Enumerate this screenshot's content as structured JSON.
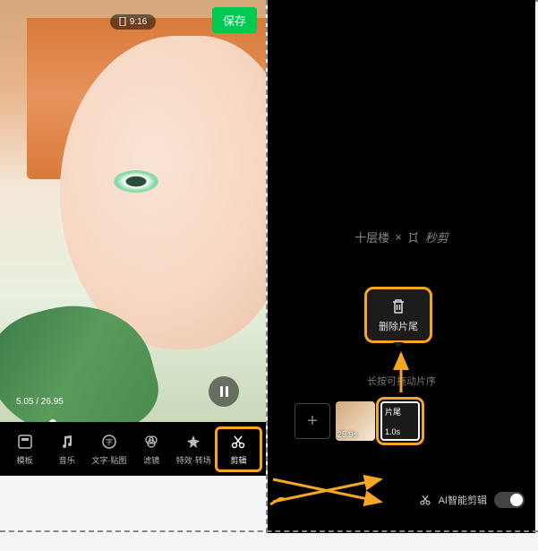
{
  "left": {
    "status_time": "9:16",
    "save_label": "保存",
    "time_display": "5.05 / 26.95",
    "toolbar": [
      {
        "icon": "template",
        "label": "模板"
      },
      {
        "icon": "music",
        "label": "音乐"
      },
      {
        "icon": "text",
        "label": "文字·贴图"
      },
      {
        "icon": "filter",
        "label": "滤镜"
      },
      {
        "icon": "effect",
        "label": "特效·转场"
      },
      {
        "icon": "edit",
        "label": "剪辑"
      }
    ]
  },
  "right": {
    "watermark_left": "十层楼",
    "watermark_sep": "×",
    "watermark_right": "秒剪",
    "delete_label": "删除片尾",
    "hint": "长按可拖动片序",
    "add_icon": "+",
    "clip1_time": "25.9s",
    "outro_label": "片尾",
    "outro_time": "1.0s",
    "ai_edit_label": "AI智能剪辑"
  }
}
